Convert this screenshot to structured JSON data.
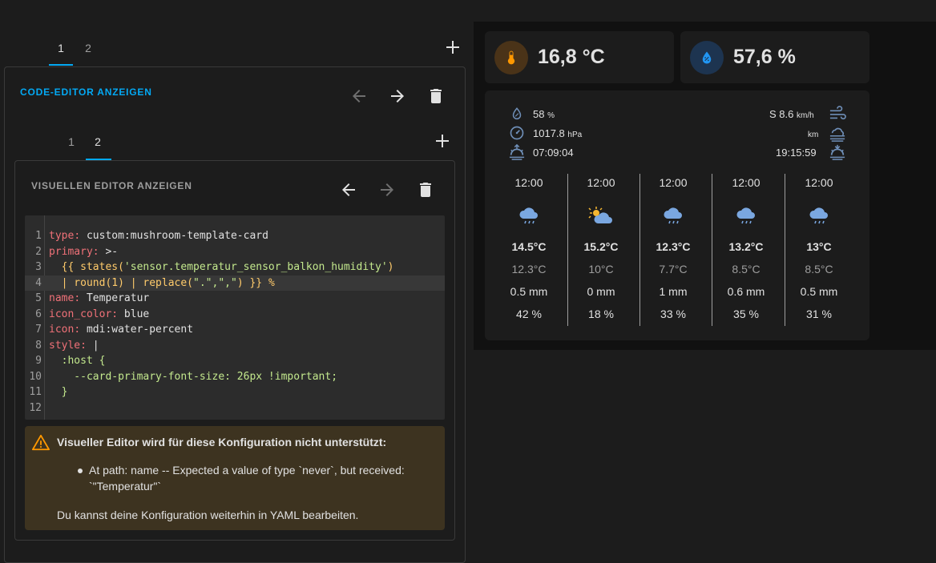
{
  "editor": {
    "outer_tabs": [
      "1",
      "2"
    ],
    "outer_action": "CODE-EDITOR ANZEIGEN",
    "inner_tabs": [
      "1",
      "2"
    ],
    "inner_action": "VISUELLEN EDITOR ANZEIGEN",
    "code_lines": [
      {
        "n": "1",
        "k": "type",
        "v": " custom:mushroom-template-card"
      },
      {
        "n": "2",
        "k": "primary",
        "v": " >-"
      },
      {
        "n": "3",
        "pre": "  {{ states(",
        "s": "'sensor.temperatur_sensor_balkon_humidity'",
        "post": ")"
      },
      {
        "n": "4",
        "pre": "  | round(1) | replace(",
        "s": "\".\",\",\"",
        "post": ") }} %"
      },
      {
        "n": "5",
        "k": "name",
        "v": " Temperatur"
      },
      {
        "n": "6",
        "k": "icon_color",
        "v": " blue"
      },
      {
        "n": "7",
        "k": "icon",
        "v": " mdi:water-percent"
      },
      {
        "n": "8",
        "k": "style",
        "v": " |"
      },
      {
        "n": "9",
        "v": "  :host {"
      },
      {
        "n": "10",
        "v": "    --card-primary-font-size: 26px !important;"
      },
      {
        "n": "11",
        "v": "  }"
      },
      {
        "n": "12",
        "v": ""
      }
    ],
    "warning": {
      "title": "Visueller Editor wird für diese Konfiguration nicht unterstützt:",
      "bullet_1": "At path: name -- Expected a value of type `never`, but received:",
      "bullet_2": "`\"Temperatur\"`",
      "footer": "Du kannst deine Konfiguration weiterhin in YAML bearbeiten."
    }
  },
  "dashboard": {
    "temp_value": "16,8 °C",
    "humidity_value": "57,6 %",
    "colors": {
      "accent": "#03a9f4",
      "temp_icon_bg": "#4a3318",
      "temp_icon": "#ff9800",
      "hum_icon_bg": "#1d3450",
      "hum_icon": "#2196f3"
    },
    "weather": {
      "humidity": "58",
      "humidity_unit": "%",
      "pressure": "1017.8",
      "pressure_unit": "hPa",
      "sunrise": "07:09:04",
      "wind": "S 8.6",
      "wind_unit": "km/h",
      "visibility_unit": "km",
      "sunset": "19:15:59",
      "forecast": [
        {
          "time": "12:00",
          "icon": "rain-cloud-icon",
          "high": "14.5°C",
          "low": "12.3°C",
          "precip": "0.5 mm",
          "prob": "42 %"
        },
        {
          "time": "12:00",
          "icon": "partly-sunny-icon",
          "high": "15.2°C",
          "low": "10°C",
          "precip": "0 mm",
          "prob": "18 %"
        },
        {
          "time": "12:00",
          "icon": "rain-cloud-icon",
          "high": "12.3°C",
          "low": "7.7°C",
          "precip": "1 mm",
          "prob": "33 %"
        },
        {
          "time": "12:00",
          "icon": "rain-cloud-icon",
          "high": "13.2°C",
          "low": "8.5°C",
          "precip": "0.6 mm",
          "prob": "35 %"
        },
        {
          "time": "12:00",
          "icon": "rain-cloud-icon",
          "high": "13°C",
          "low": "8.5°C",
          "precip": "0.5 mm",
          "prob": "31 %"
        }
      ]
    }
  }
}
